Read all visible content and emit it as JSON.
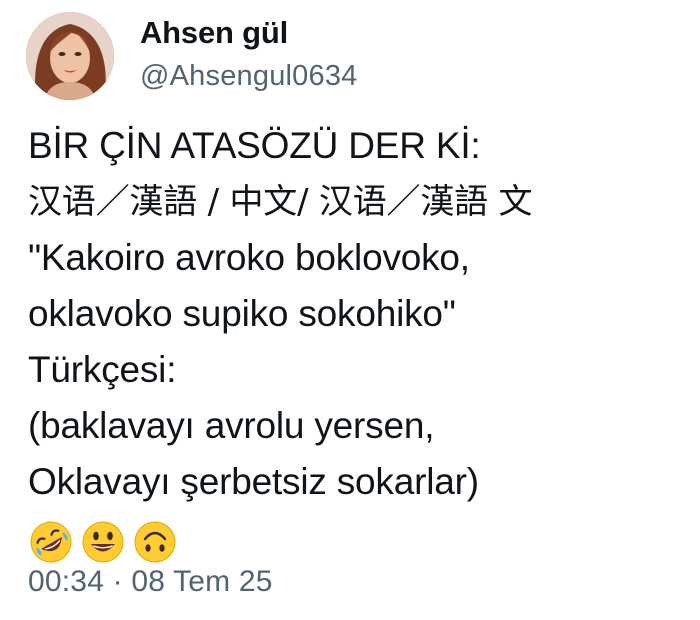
{
  "author": {
    "display_name": "Ahsen gül",
    "handle": "@Ahsengul0634"
  },
  "post": {
    "lines": [
      "BİR ÇİN ATASÖZÜ DER Kİ:",
      "汉语／漢語 / 中文/ 汉语／漢語 文",
      "\"Kakoiro avroko boklovoko,",
      "oklavoko supiko sokohiko\"",
      "Türkçesi:",
      "(baklavayı avrolu yersen,",
      "Oklavayı şerbetsiz sokarlar)"
    ],
    "emojis": [
      "rolling-on-floor-laughing-emoji",
      "grinning-face-emoji",
      "upside-down-face-emoji"
    ]
  },
  "timestamp": "00:34 · 08 Tem 25",
  "colors": {
    "text_primary": "#0f1419",
    "text_secondary": "#536471",
    "emoji_yellow": "#ffcc33"
  }
}
